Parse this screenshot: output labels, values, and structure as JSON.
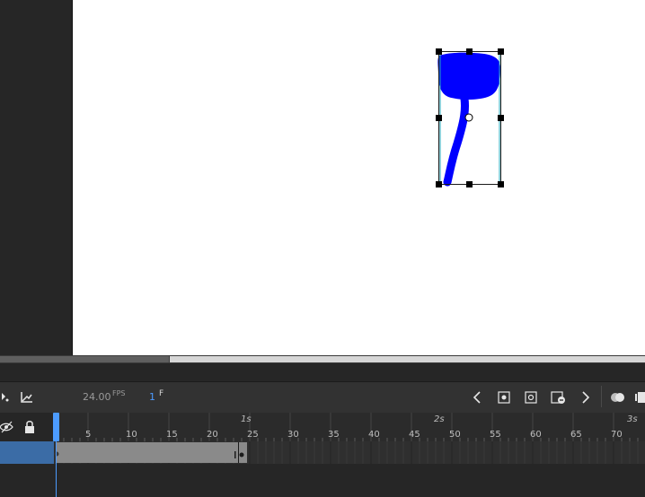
{
  "timeline": {
    "fps_value": "24.00",
    "fps_unit": "FPS",
    "current_frame": "1",
    "frame_unit": "F",
    "frame_labels": [
      "5",
      "10",
      "15",
      "20",
      "25",
      "30",
      "35",
      "40",
      "45",
      "50",
      "55",
      "60",
      "65",
      "70"
    ],
    "second_labels": [
      "1s",
      "2s",
      "3s"
    ]
  },
  "icons": {
    "paint_bucket": "paint-bucket-icon",
    "graph": "graph-icon",
    "prev_keyframe": "chevron-left-icon",
    "insert_keyframe": "insert-keyframe-icon",
    "insert_blank_keyframe": "insert-blank-keyframe-icon",
    "remove_keyframe": "remove-keyframe-icon",
    "next_keyframe": "chevron-right-icon",
    "onion_skin": "onion-skin-icon",
    "edit_multiple": "edit-multiple-frames-icon",
    "visibility": "eye-slash-icon",
    "lock": "lock-icon"
  },
  "colors": {
    "drawing_fill": "#0000ff",
    "accent": "#4c9bff",
    "stage": "#ffffff"
  }
}
